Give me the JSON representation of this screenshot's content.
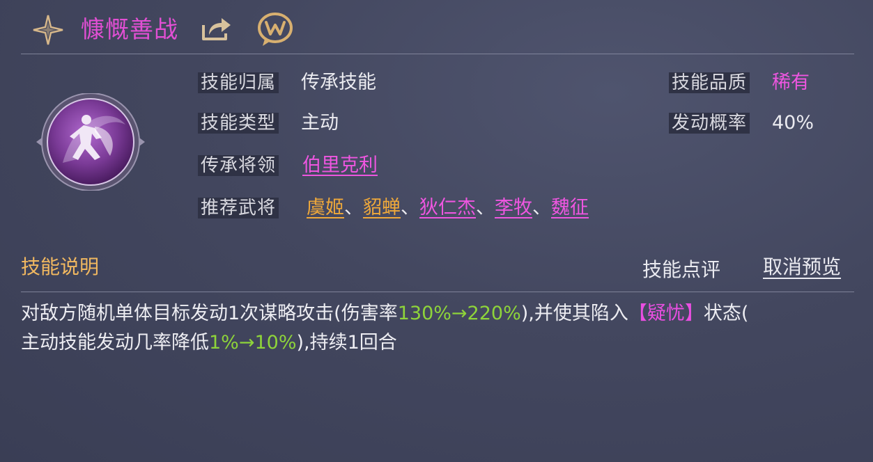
{
  "skill": {
    "name": "慷慨善战",
    "icon": "running-figure-emblem",
    "belong_label": "技能归属",
    "belong_value": "传承技能",
    "type_label": "技能类型",
    "type_value": "主动",
    "inherit_label": "传承将领",
    "inherit_value": "伯里克利",
    "recommend_label": "推荐武将",
    "recommended": [
      {
        "name": "虞姬",
        "color": "#f0a93a"
      },
      {
        "name": "貂蝉",
        "color": "#f0a93a"
      },
      {
        "name": "狄仁杰",
        "color": "#ee56e0"
      },
      {
        "name": "李牧",
        "color": "#ee56e0"
      },
      {
        "name": "魏征",
        "color": "#ee56e0"
      }
    ],
    "separator": "、",
    "quality_label": "技能品质",
    "quality_value": "稀有",
    "chance_label": "发动概率",
    "chance_value": "40%"
  },
  "description": {
    "title": "技能说明",
    "review_label": "技能点评",
    "cancel_preview_label": "取消预览",
    "line1_a": "对敌方随机单体目标发动1次谋略攻击(伤害率",
    "line1_b": "130%→220%",
    "line1_c": "),并使其陷入",
    "line1_d": "【疑忧】",
    "line1_e": "状态(",
    "line2_a": "主动技能发动几率降低",
    "line2_b": "1%→10%",
    "line2_c": "),持续1回合"
  },
  "icons": [
    "star-compass-icon",
    "share-icon",
    "wechat-icon"
  ]
}
